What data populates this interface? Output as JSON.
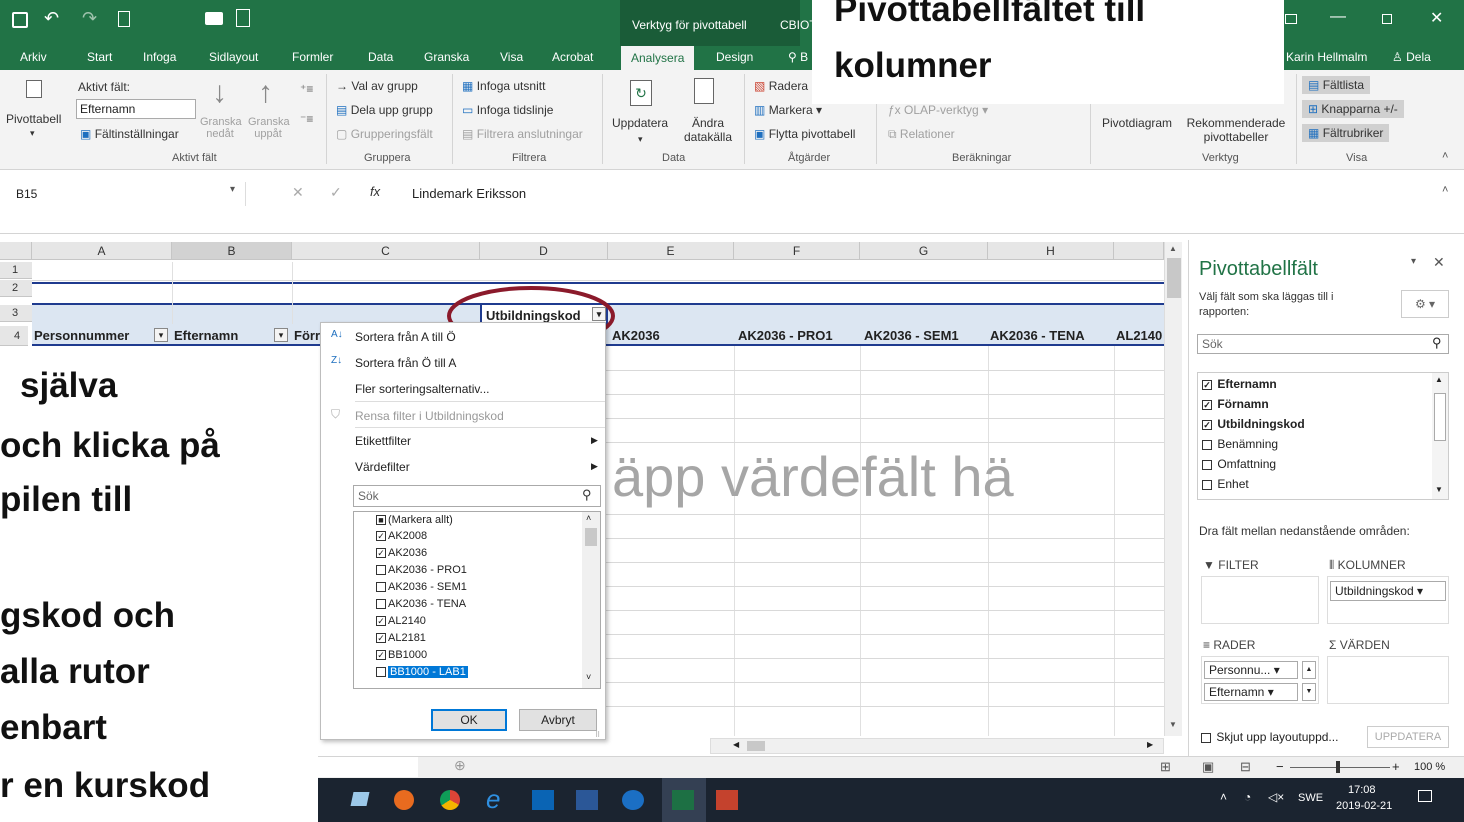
{
  "title_bar": {
    "context_tab_label": "Verktyg för pivottabell",
    "app_fragment": "CBIOT",
    "user": "Karin Hellmalm",
    "share": "Dela"
  },
  "tabs": [
    "Arkiv",
    "Start",
    "Infoga",
    "Sidlayout",
    "Formler",
    "Data",
    "Granska",
    "Visa",
    "Acrobat",
    "Analysera",
    "Design"
  ],
  "tab_search_fragment": "B",
  "ribbon": {
    "pivottabell": "Pivottabell",
    "aktivt_falt_label": "Aktivt fält:",
    "aktivt_falt_value": "Efternamn",
    "faltinstallningar": "Fältinställningar",
    "granska_nedat": "Granska nedåt",
    "granska_uppat": "Granska uppåt",
    "group_aktivt": "Aktivt fält",
    "val_av_grupp": "Val av grupp",
    "dela_upp_grupp": "Dela upp grupp",
    "grupperingsfalt": "Grupperingsfält",
    "group_gruppera": "Gruppera",
    "infoga_utsnitt": "Infoga utsnitt",
    "infoga_tidslinje": "Infoga tidslinje",
    "filtrera_anslutningar": "Filtrera anslutningar",
    "group_filtrera": "Filtrera",
    "uppdatera": "Uppdatera",
    "andra_datakalla": "Ändra datakälla",
    "group_data": "Data",
    "radera": "Radera",
    "markera": "Markera",
    "flytta": "Flytta pivottabell",
    "group_atgarder": "Åtgärder",
    "olap": "OLAP-verktyg",
    "relationer": "Relationer",
    "group_berakningar": "Beräkningar",
    "pivotdiagram": "Pivotdiagram",
    "rekommenderade": "Rekommenderade pivottabeller",
    "group_verktyg": "Verktyg",
    "faltlista": "Fältlista",
    "knapparna": "Knapparna +/-",
    "faltrubriker": "Fältrubriker",
    "group_visa": "Visa"
  },
  "formula_bar": {
    "name_box": "B15",
    "fx": "fx",
    "value": "Lindemark Eriksson"
  },
  "grid": {
    "columns": [
      "A",
      "B",
      "C",
      "D",
      "E",
      "F",
      "G",
      "H"
    ],
    "rows": [
      "1",
      "2",
      "3",
      "4"
    ],
    "row3_header": "Utbildningskod",
    "row4": [
      "Personnummer",
      "Efternamn",
      "Förr",
      "AK2036",
      "AK2036 - PRO1",
      "AK2036 - SEM1",
      "AK2036 - TENA",
      "AL2140"
    ],
    "watermark": "äpp värdefält hä"
  },
  "dropdown": {
    "sort_az": "Sortera från A till Ö",
    "sort_za": "Sortera från Ö till A",
    "more_sort": "Fler sorteringsalternativ...",
    "clear_filter": "Rensa filter i Utbildningskod",
    "label_filter": "Etikettfilter",
    "value_filter": "Värdefilter",
    "search_placeholder": "Sök",
    "items": [
      {
        "label": "(Markera allt)",
        "state": "partial"
      },
      {
        "label": "AK2008",
        "state": "checked"
      },
      {
        "label": "AK2036",
        "state": "checked"
      },
      {
        "label": "AK2036 - PRO1",
        "state": "unchecked"
      },
      {
        "label": "AK2036 - SEM1",
        "state": "unchecked"
      },
      {
        "label": "AK2036 - TENA",
        "state": "unchecked"
      },
      {
        "label": "AL2140",
        "state": "checked"
      },
      {
        "label": "AL2181",
        "state": "checked"
      },
      {
        "label": "BB1000",
        "state": "checked"
      },
      {
        "label": "BB1000 - LAB1",
        "state": "unchecked"
      }
    ],
    "ok": "OK",
    "cancel": "Avbryt"
  },
  "pane": {
    "title": "Pivottabellfält",
    "subtitle": "Välj fält som ska läggas till i rapporten:",
    "search": "Sök",
    "fields": [
      {
        "label": "Efternamn",
        "checked": true
      },
      {
        "label": "Förnamn",
        "checked": true
      },
      {
        "label": "Utbildningskod",
        "checked": true
      },
      {
        "label": "Benämning",
        "checked": false
      },
      {
        "label": "Omfattning",
        "checked": false
      },
      {
        "label": "Enhet",
        "checked": false
      }
    ],
    "drag_hint": "Dra fält mellan nedanstående områden:",
    "filter": "FILTER",
    "kolumner": "KOLUMNER",
    "kolumner_item": "Utbildningskod",
    "rader": "RADER",
    "varden": "VÄRDEN",
    "rader_items": [
      "Personnu...",
      "Efternamn"
    ],
    "defer": "Skjut upp layoutuppd...",
    "update": "UPPDATERA"
  },
  "status": {
    "zoom": "100 %"
  },
  "taskbar": {
    "lang": "SWE",
    "time": "17:08",
    "date": "2019-02-21"
  },
  "overlay": {
    "title_line1": "Pivottabellfältet till",
    "title_line2": "kolumner",
    "left_lines": [
      "själva",
      "och klicka på",
      "pilen till",
      "",
      "gskod och",
      "alla rutor",
      "enbart",
      "r en kurskod"
    ]
  },
  "colors": {
    "excel_green": "#217346",
    "annotation": "#8b1a2b",
    "selection": "#0078d7"
  }
}
